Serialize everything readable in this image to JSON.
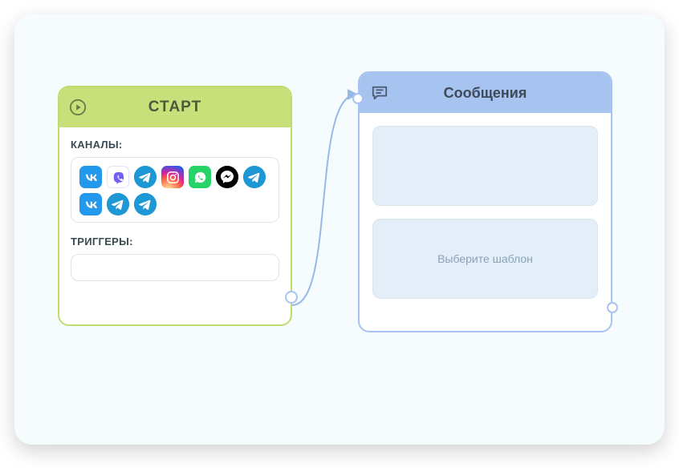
{
  "start": {
    "title": "СТАРТ",
    "channels_label": "КАНАЛЫ:",
    "triggers_label": "ТРИГГЕРЫ:",
    "channels": [
      {
        "name": "vk",
        "bg": "#2299ec",
        "shape": "rounded",
        "glyph": "vk"
      },
      {
        "name": "viber",
        "bg": "#ffffff",
        "shape": "rounded",
        "glyph": "viber",
        "fg": "#7360f2",
        "border": "#e6e0fb"
      },
      {
        "name": "telegram",
        "bg": "#1e98d4",
        "shape": "circle",
        "glyph": "telegram"
      },
      {
        "name": "instagram",
        "bg": "#e1306c",
        "shape": "rounded",
        "glyph": "instagram",
        "grad": true
      },
      {
        "name": "whatsapp",
        "bg": "#25d366",
        "shape": "rounded",
        "glyph": "whatsapp"
      },
      {
        "name": "messenger",
        "bg": "#000000",
        "shape": "circle",
        "glyph": "messenger"
      },
      {
        "name": "telegram",
        "bg": "#1e98d4",
        "shape": "circle",
        "glyph": "telegram"
      },
      {
        "name": "vk",
        "bg": "#2299ec",
        "shape": "rounded",
        "glyph": "vk"
      },
      {
        "name": "telegram",
        "bg": "#1e98d4",
        "shape": "circle",
        "glyph": "telegram"
      },
      {
        "name": "telegram",
        "bg": "#1e98d4",
        "shape": "circle",
        "glyph": "telegram"
      }
    ]
  },
  "messages": {
    "title": "Сообщения",
    "placeholder_box1": "",
    "placeholder_box2": "Выберите шаблон"
  }
}
